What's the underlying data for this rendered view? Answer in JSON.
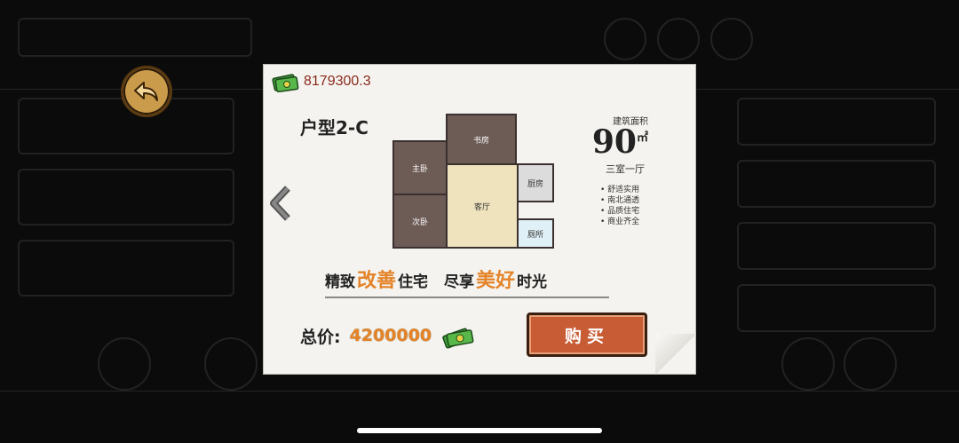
{
  "wallet": {
    "balance": "8179300.3",
    "icon": "cash-stack-icon"
  },
  "listing": {
    "type_label": "户型2-C",
    "area_title": "建筑面积",
    "area_value": "90",
    "area_unit": "㎡",
    "rooms_desc": "三室一厅",
    "features": [
      "舒适实用",
      "南北通透",
      "品质住宅",
      "商业齐全"
    ],
    "floorplan_rooms": [
      "书房",
      "主卧",
      "客厅",
      "厨房",
      "次卧",
      "厕所"
    ]
  },
  "slogan": {
    "part1": "精致",
    "hl1": "改善",
    "part2": "住宅",
    "part3": "尽享",
    "hl2": "美好",
    "part4": "时光"
  },
  "price": {
    "label": "总价:",
    "value": "4200000"
  },
  "buy_button": {
    "label": "购买"
  },
  "colors": {
    "accent": "#e4842a",
    "button": "#c85c34",
    "money_text": "#8a2a1c"
  }
}
